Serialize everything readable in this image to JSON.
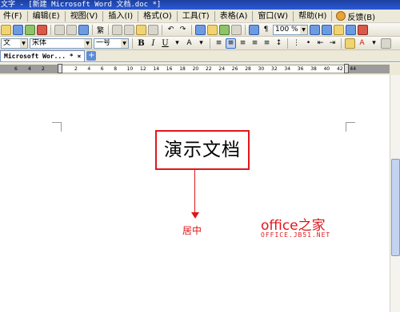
{
  "window": {
    "title": "文字 - [新建 Microsoft Word 文档.doc *]"
  },
  "menu": [
    "件(F)",
    "编辑(E)",
    "视图(V)",
    "插入(I)",
    "格式(O)",
    "工具(T)",
    "表格(A)",
    "窗口(W)",
    "帮助(H)"
  ],
  "feedback_label": "反馈(B)",
  "toolbar": {
    "style_combo": "文",
    "font_combo": "宋体",
    "size_combo": "一号",
    "zoom_combo": "100 %",
    "bold": "B",
    "italic": "I",
    "underline": "U",
    "paragraph_label": "繁"
  },
  "tab": {
    "label": "Microsoft Wor... *",
    "close": "×",
    "add": "+"
  },
  "ruler": {
    "numbers": [
      "6",
      "4",
      "2",
      "2",
      "4",
      "6",
      "8",
      "10",
      "12",
      "14",
      "16",
      "18",
      "20",
      "22",
      "24",
      "26",
      "28",
      "30",
      "32",
      "34",
      "36",
      "38",
      "40",
      "42",
      "44"
    ]
  },
  "document": {
    "title_text": "演示文档"
  },
  "annotation": {
    "label": "居中"
  },
  "watermark": {
    "main": "office之家",
    "sub": "OFFICE.JB51.NET"
  },
  "colors": {
    "annotation_red": "#e0161a",
    "title_bar": "#2a5ad6"
  }
}
